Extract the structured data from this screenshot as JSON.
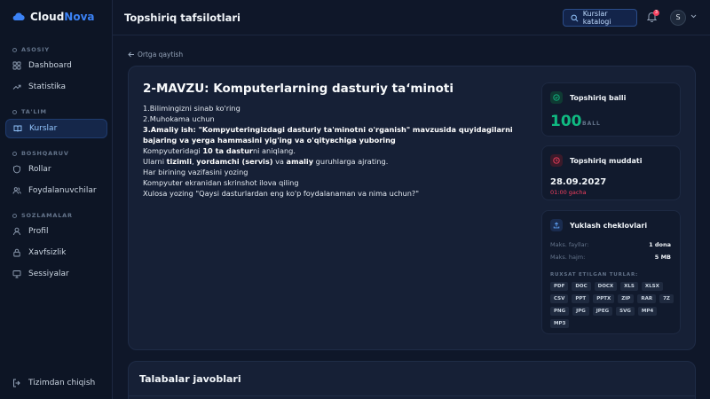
{
  "app": {
    "brand_a": "Cloud",
    "brand_b": "Nova"
  },
  "sidebar": {
    "sections": [
      {
        "label": "ASOSIY",
        "items": [
          {
            "label": "Dashboard",
            "icon": "grid-icon"
          },
          {
            "label": "Statistika",
            "icon": "trend-icon"
          }
        ]
      },
      {
        "label": "TA'LIM",
        "items": [
          {
            "label": "Kurslar",
            "icon": "book-icon",
            "active": true
          }
        ]
      },
      {
        "label": "BOSHQARUV",
        "items": [
          {
            "label": "Rollar",
            "icon": "shield-icon"
          },
          {
            "label": "Foydalanuvchilar",
            "icon": "users-icon"
          }
        ]
      },
      {
        "label": "SOZLAMALAR",
        "items": [
          {
            "label": "Profil",
            "icon": "user-icon"
          },
          {
            "label": "Xavfsizlik",
            "icon": "lock-icon"
          },
          {
            "label": "Sessiyalar",
            "icon": "monitor-icon"
          }
        ]
      }
    ],
    "logout": "Tizimdan chiqish"
  },
  "header": {
    "title": "Topshiriq tafsilotlari",
    "catalog_button": "Kurslar katalogi",
    "notification_count": "3",
    "avatar_initial": "S"
  },
  "back_link": "Ortga qaytish",
  "task": {
    "title": "2-MAVZU: Komputerlarning dasturiy ta‘minoti",
    "lines": [
      [
        {
          "t": "1.Bilimingizni sinab ko'ring"
        }
      ],
      [
        {
          "t": "2.Muhokama uchun"
        }
      ],
      [
        {
          "t": "3.Amaliy ish: \"Kompyuteringizdagi dasturiy ta'minotni o'rganish\" mavzusida quyidagilarni bajaring va yerga hammasini yig'ing va o'qitувchiga yuboring",
          "b": true
        }
      ],
      [
        {
          "t": "Kompyuteridagi "
        },
        {
          "t": "10 ta dastur",
          "b": true
        },
        {
          "t": "ni aniqlang."
        }
      ],
      [
        {
          "t": "Ularni "
        },
        {
          "t": "tizimli",
          "b": true
        },
        {
          "t": ", "
        },
        {
          "t": "yordamchi (servis)",
          "b": true
        },
        {
          "t": " va "
        },
        {
          "t": "amaliy",
          "b": true
        },
        {
          "t": " guruhlarga ajrating."
        }
      ],
      [
        {
          "t": "Har birining vazifasini yozing"
        }
      ],
      [
        {
          "t": "Kompyuter ekranidan skrinshot ilova qiling"
        }
      ],
      [
        {
          "t": "Xulosa yozing \"Qaysi dasturlardan eng ko'p foydalanaman va nima uchun?\""
        }
      ]
    ]
  },
  "score_box": {
    "title": "Topshiriq balli",
    "value": "100",
    "unit": "BALL"
  },
  "deadline_box": {
    "title": "Topshiriq muddati",
    "date": "28.09.2027",
    "time": "01:00 gacha"
  },
  "upload_box": {
    "title": "Yuklash cheklovlari",
    "max_files_label": "Maks. fayllar:",
    "max_files_value": "1 dona",
    "max_size_label": "Maks. hajm:",
    "max_size_value": "5 MB",
    "types_label": "RUXSAT ETILGAN TURLAR:",
    "types": [
      "PDF",
      "DOC",
      "DOCX",
      "XLS",
      "XLSX",
      "CSV",
      "PPT",
      "PPTX",
      "ZIP",
      "RAR",
      "7Z",
      "PNG",
      "JPG",
      "JPEG",
      "SVG",
      "MP4",
      "MP3"
    ]
  },
  "answers": {
    "title": "Talabalar javoblari"
  },
  "colors": {
    "accent": "#3b82f6",
    "score": "#10b981",
    "deadline": "#f43f5e"
  }
}
